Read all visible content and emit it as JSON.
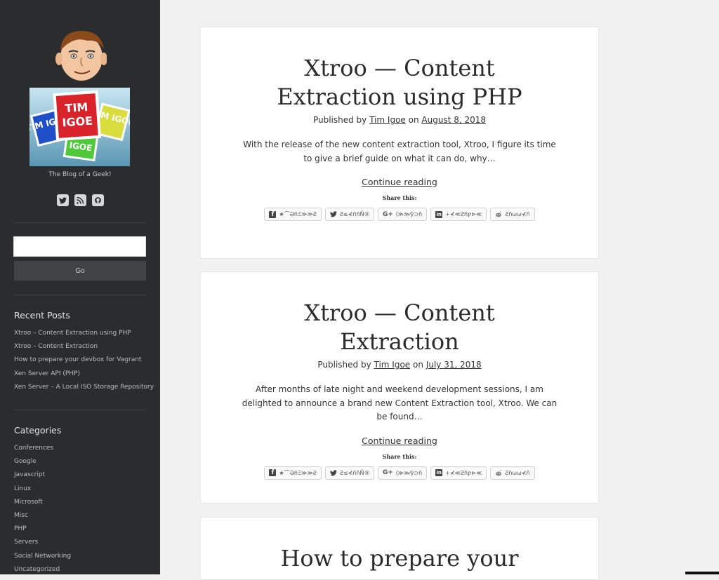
{
  "sidebar": {
    "tagline": "The Blog of a Geek!",
    "logo_text": {
      "main": "TIM IGOE",
      "left": "TIM IGOE",
      "right": "TIM IGOE",
      "bottom": "IGOE"
    },
    "social": [
      "twitter-icon",
      "rss-icon",
      "github-icon"
    ],
    "search": {
      "value": "",
      "placeholder": "",
      "button": "Go"
    },
    "recent_posts": {
      "title": "Recent Posts",
      "items": [
        "Xtroo – Content Extraction using PHP",
        "Xtroo – Content Extraction",
        "How to prepare your devbox for Vagrant",
        "Xen Server API (PHP)",
        "Xen Server – A Local ISO Storage Repository"
      ]
    },
    "categories": {
      "title": "Categories",
      "items": [
        "Conferences",
        "Google",
        "Javascript",
        "Linux",
        "Microsoft",
        "Misc",
        "PHP",
        "Servers",
        "Social Networking",
        "Uncategorized"
      ]
    }
  },
  "posts": [
    {
      "title": "Xtroo — Content Extraction using PHP",
      "published_by": "Published by",
      "author": "Tim Igoe",
      "on": "on",
      "date": "August 8, 2018",
      "excerpt": "With the release of the new content extraction tool, Xtroo, I figure its time to give a brief guide on what it can do, why…",
      "continue": "Continue reading",
      "share_title": "Share this:",
      "share": [
        {
          "icon": "facebook-icon",
          "label": "★⌒ƏñΞ≫≫Ƨ"
        },
        {
          "icon": "twitter-icon",
          "label": "Ƨ≤⊀ññÑ®"
        },
        {
          "icon": "google-plus-icon",
          "label": "⟨≫≫⁄ÿ⊃ñ"
        },
        {
          "icon": "linkedin-icon",
          "label": "+⊀≪Ƨñƿ⊳≪"
        },
        {
          "icon": "reddit-icon",
          "label": "Ƨñωω⊀ñ"
        }
      ]
    },
    {
      "title": "Xtroo — Content Extraction",
      "published_by": "Published by",
      "author": "Tim Igoe",
      "on": "on",
      "date": "July 31, 2018",
      "excerpt": "After months of late night and weekend development sessions, I am delighted to announce a brand new Content Extraction tool, Xtroo. We can be found…",
      "continue": "Continue reading",
      "share_title": "Share this:",
      "share": [
        {
          "icon": "facebook-icon",
          "label": "★⌒ƏñΞ≫≫Ƨ"
        },
        {
          "icon": "twitter-icon",
          "label": "Ƨ≤⊀ññÑ®"
        },
        {
          "icon": "google-plus-icon",
          "label": "⟨≫≫⁄ÿ⊃ñ"
        },
        {
          "icon": "linkedin-icon",
          "label": "+⊀≪Ƨñƿ⊳≪"
        },
        {
          "icon": "reddit-icon",
          "label": "Ƨñωω⊀ñ"
        }
      ]
    },
    {
      "title": "How to prepare your"
    }
  ]
}
